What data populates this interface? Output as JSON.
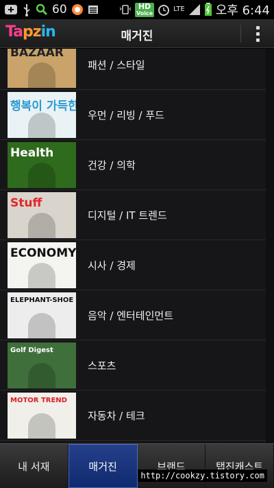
{
  "status_bar": {
    "battery_count": "60",
    "hd_voice": [
      "HD",
      "Voice"
    ],
    "network": "LTE",
    "time": "오후 6:44"
  },
  "header": {
    "logo": [
      "Ta",
      "pz",
      "in"
    ],
    "title": "매거진"
  },
  "categories": [
    {
      "label": "패션 / 스타일",
      "thumb_text": "BAZAAR",
      "thumb_bg": "#c9a36a",
      "thumb_fg": "#222"
    },
    {
      "label": "우먼 / 리빙 / 푸드",
      "thumb_text": "행복이 가득한 집",
      "thumb_bg": "#e9f2f4",
      "thumb_fg": "#2a9ad1"
    },
    {
      "label": "건강 / 의학",
      "thumb_text": "Health",
      "thumb_bg": "#2e6b1c",
      "thumb_fg": "#fff"
    },
    {
      "label": "디지털 / IT 트렌드",
      "thumb_text": "Stuff",
      "thumb_bg": "#d9d4cc",
      "thumb_fg": "#e3262b"
    },
    {
      "label": "시사 / 경제",
      "thumb_text": "ECONOMY",
      "thumb_bg": "#f4f4f1",
      "thumb_fg": "#111"
    },
    {
      "label": "음악 / 엔터테인먼트",
      "thumb_text": "ELEPHANT-SHOE",
      "thumb_bg": "#ededed",
      "thumb_fg": "#111"
    },
    {
      "label": "스포츠",
      "thumb_text": "Golf Digest",
      "thumb_bg": "#3f6f3b",
      "thumb_fg": "#fff"
    },
    {
      "label": "자동차 / 테크",
      "thumb_text": "MOTOR TREND",
      "thumb_bg": "#f0efe9",
      "thumb_fg": "#d81f26"
    }
  ],
  "tabs": [
    {
      "label": "내 서재",
      "active": false
    },
    {
      "label": "매거진",
      "active": true
    },
    {
      "label": "브랜드",
      "active": false
    },
    {
      "label": "탭진캐스트",
      "active": false
    }
  ],
  "watermark": "http://cookzy.tistory.com"
}
